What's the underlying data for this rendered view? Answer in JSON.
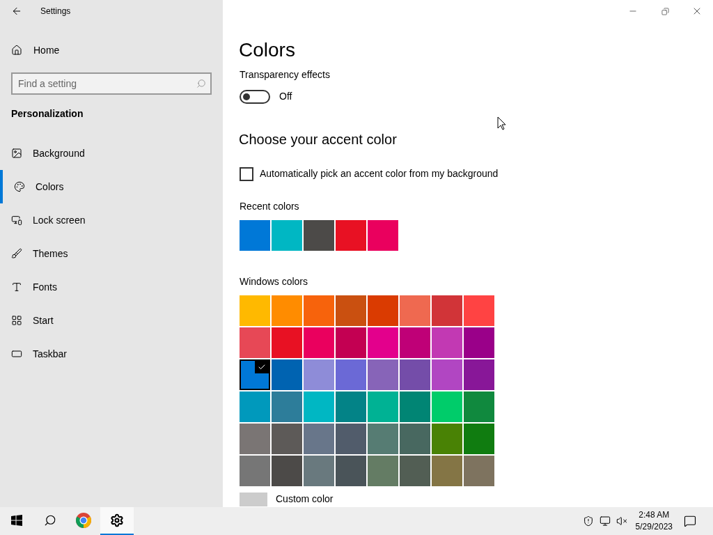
{
  "window": {
    "title": "Settings"
  },
  "sidebar": {
    "home": "Home",
    "search": {
      "placeholder": "Find a setting"
    },
    "section": "Personalization",
    "items": [
      {
        "label": "Background",
        "kind": "image",
        "selected": false
      },
      {
        "label": "Colors",
        "kind": "palette",
        "selected": true
      },
      {
        "label": "Lock screen",
        "kind": "lock",
        "selected": false
      },
      {
        "label": "Themes",
        "kind": "themes",
        "selected": false
      },
      {
        "label": "Fonts",
        "kind": "fonts",
        "selected": false
      },
      {
        "label": "Start",
        "kind": "start",
        "selected": false
      },
      {
        "label": "Taskbar",
        "kind": "taskbar",
        "selected": false
      }
    ]
  },
  "page": {
    "title": "Colors",
    "transparency": {
      "label": "Transparency effects",
      "on": false,
      "state_text": "Off"
    },
    "accent_heading": "Choose your accent color",
    "auto_pick": {
      "label": "Automatically pick an accent color from my background",
      "checked": false
    },
    "recent_label": "Recent colors",
    "recent_colors": [
      {
        "color": "#0078d7"
      },
      {
        "color": "#00b7c3"
      },
      {
        "color": "#4c4a48"
      },
      {
        "color": "#e81123"
      },
      {
        "color": "#ea005e"
      }
    ],
    "windows_label": "Windows colors",
    "windows_colors": [
      {
        "color": "#ffb900",
        "selected": false
      },
      {
        "color": "#ff8c00",
        "selected": false
      },
      {
        "color": "#f7630c",
        "selected": false
      },
      {
        "color": "#ca5010",
        "selected": false
      },
      {
        "color": "#da3b01",
        "selected": false
      },
      {
        "color": "#ef6950",
        "selected": false
      },
      {
        "color": "#d13438",
        "selected": false
      },
      {
        "color": "#ff4343",
        "selected": false
      },
      {
        "color": "#e74856",
        "selected": false
      },
      {
        "color": "#e81123",
        "selected": false
      },
      {
        "color": "#ea005e",
        "selected": false
      },
      {
        "color": "#c30052",
        "selected": false
      },
      {
        "color": "#e3008c",
        "selected": false
      },
      {
        "color": "#bf0077",
        "selected": false
      },
      {
        "color": "#c239b3",
        "selected": false
      },
      {
        "color": "#9a0089",
        "selected": false
      },
      {
        "color": "#0078d7",
        "selected": true
      },
      {
        "color": "#0063b1",
        "selected": false
      },
      {
        "color": "#8e8cd8",
        "selected": false
      },
      {
        "color": "#6b69d6",
        "selected": false
      },
      {
        "color": "#8764b8",
        "selected": false
      },
      {
        "color": "#744da9",
        "selected": false
      },
      {
        "color": "#b146c2",
        "selected": false
      },
      {
        "color": "#881798",
        "selected": false
      },
      {
        "color": "#0099bc",
        "selected": false
      },
      {
        "color": "#2d7d9a",
        "selected": false
      },
      {
        "color": "#00b7c3",
        "selected": false
      },
      {
        "color": "#038387",
        "selected": false
      },
      {
        "color": "#00b294",
        "selected": false
      },
      {
        "color": "#018574",
        "selected": false
      },
      {
        "color": "#00cc6a",
        "selected": false
      },
      {
        "color": "#10893e",
        "selected": false
      },
      {
        "color": "#7a7574",
        "selected": false
      },
      {
        "color": "#5d5a58",
        "selected": false
      },
      {
        "color": "#68768a",
        "selected": false
      },
      {
        "color": "#515c6b",
        "selected": false
      },
      {
        "color": "#567c73",
        "selected": false
      },
      {
        "color": "#486860",
        "selected": false
      },
      {
        "color": "#498205",
        "selected": false
      },
      {
        "color": "#107c10",
        "selected": false
      },
      {
        "color": "#767676",
        "selected": false
      },
      {
        "color": "#4c4a48",
        "selected": false
      },
      {
        "color": "#69797e",
        "selected": false
      },
      {
        "color": "#4a5459",
        "selected": false
      },
      {
        "color": "#647c64",
        "selected": false
      },
      {
        "color": "#525e54",
        "selected": false
      },
      {
        "color": "#847545",
        "selected": false
      },
      {
        "color": "#7e735f",
        "selected": false
      }
    ],
    "custom_color": "Custom color"
  },
  "taskbar": {
    "apps": [
      {
        "kind": "start",
        "selected": false
      },
      {
        "kind": "search",
        "selected": false
      },
      {
        "kind": "browser",
        "selected": false
      },
      {
        "kind": "settings",
        "selected": true
      }
    ],
    "time": "2:48 AM",
    "date": "5/29/2023"
  }
}
